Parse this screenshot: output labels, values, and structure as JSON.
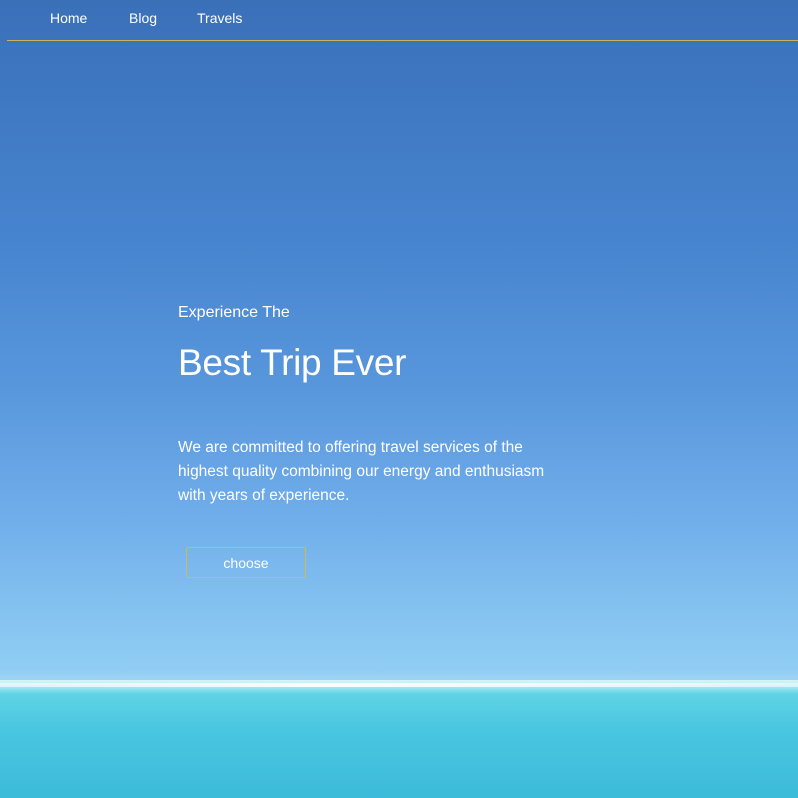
{
  "nav": {
    "items": [
      {
        "label": "Home"
      },
      {
        "label": "Blog"
      },
      {
        "label": "Travels"
      }
    ]
  },
  "hero": {
    "eyebrow": "Experience The",
    "headline": "Best Trip Ever",
    "description": "We are committed to offering travel services of the highest quality combining our energy and enthusiasm with years of experience.",
    "cta_label": "choose"
  },
  "colors": {
    "sky_top": "#3a70b8",
    "sky_bottom": "#9bd3f4",
    "sea": "#49c6e0",
    "accent_border": "#d8b84a",
    "text": "#ffffff"
  }
}
